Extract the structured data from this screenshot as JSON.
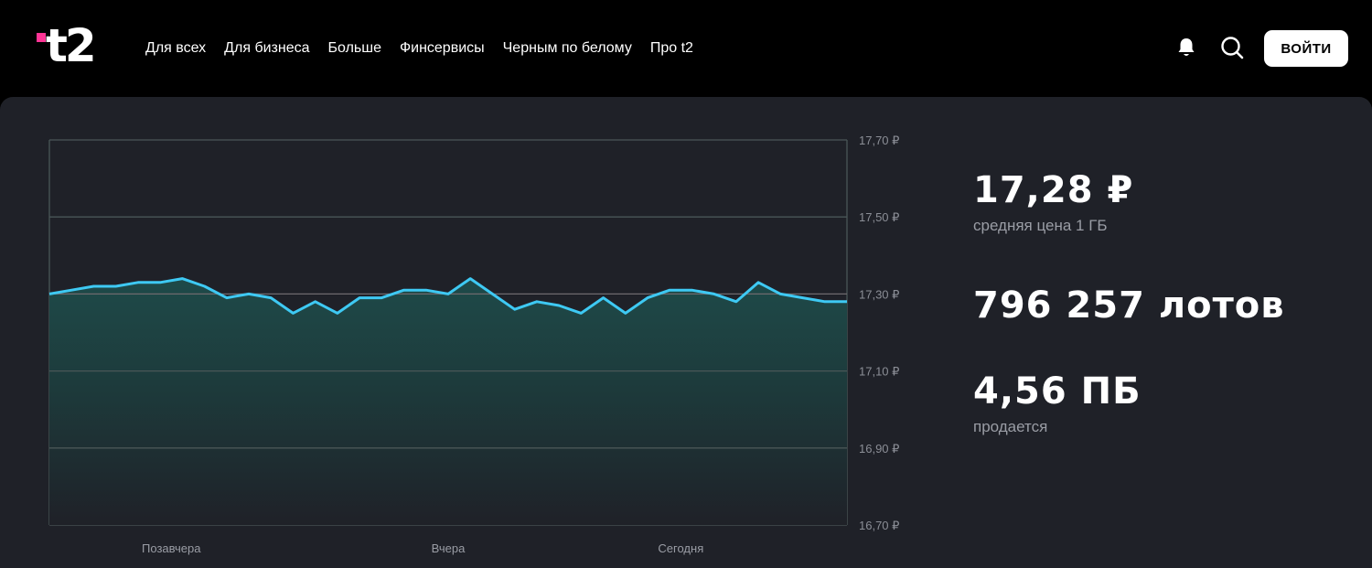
{
  "header": {
    "logo": "t2",
    "nav": [
      "Для всех",
      "Для бизнеса",
      "Больше",
      "Финсервисы",
      "Черным по белому",
      "Про t2"
    ],
    "login_label": "ВОЙТИ",
    "icons": [
      "bell-icon",
      "search-icon"
    ]
  },
  "stats": {
    "price_value": "17,28 ₽",
    "price_label": "средняя цена 1 ГБ",
    "lots_value": "796 257 лотов",
    "volume_value": "4,56 ПБ",
    "volume_label": "продается"
  },
  "colors": {
    "accent_pink": "#ff3495",
    "line": "#3ec9f3",
    "panel_bg": "#1f2128"
  },
  "chart_data": {
    "type": "area",
    "y_tick_labels": [
      "17,70 ₽",
      "17,50 ₽",
      "17,30 ₽",
      "17,10 ₽",
      "16,90 ₽",
      "16,70 ₽"
    ],
    "ylim": [
      16.7,
      17.7
    ],
    "x_labels": [
      {
        "label": "Позавчера",
        "at": 5.5
      },
      {
        "label": "Вчера",
        "at": 18
      },
      {
        "label": "Сегодня",
        "at": 28.5
      }
    ],
    "series": [
      {
        "values": [
          17.3,
          17.31,
          17.32,
          17.32,
          17.33,
          17.33,
          17.34,
          17.32,
          17.29,
          17.3,
          17.29,
          17.25,
          17.28,
          17.25,
          17.29,
          17.29,
          17.31,
          17.31,
          17.3,
          17.34,
          17.3,
          17.26,
          17.28,
          17.27,
          17.25,
          17.29,
          17.25,
          17.29,
          17.31,
          17.31,
          17.3,
          17.28,
          17.33,
          17.3,
          17.29,
          17.28,
          17.28
        ]
      }
    ],
    "grid": true
  }
}
